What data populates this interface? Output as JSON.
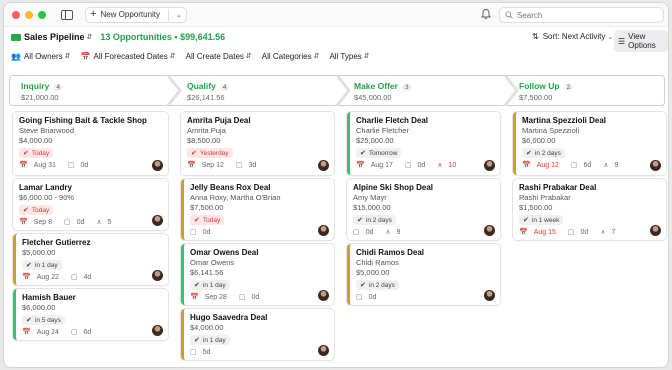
{
  "toolbar": {
    "new_label": "New Opportunity",
    "search_placeholder": "Search"
  },
  "header": {
    "pipeline": "Sales Pipeline",
    "summary": "13 Opportunities • $99,641.56",
    "sort": "Sort: Next Activity",
    "view_options": "View Options"
  },
  "filters": [
    "All Owners",
    "All Forecasted Dates",
    "All Create Dates",
    "All Categories",
    "All Types"
  ],
  "stages": [
    {
      "name": "Inquiry",
      "count": "4",
      "amount": "$21,000.00"
    },
    {
      "name": "Qualify",
      "count": "4",
      "amount": "$26,141.56"
    },
    {
      "name": "Make Offer",
      "count": "3",
      "amount": "$45,000.00"
    },
    {
      "name": "Follow Up",
      "count": "2",
      "amount": "$7,500.00"
    }
  ],
  "cards": {
    "c1": {
      "title": "Going Fishing Bait & Tackle Shop",
      "sub": "Steve Briarwood",
      "amt": "$4,000.00",
      "badge": "Today",
      "date": "Aug 31",
      "n1": "0d"
    },
    "c2": {
      "title": "Lamar Landry",
      "amt": "$6,000.00 - 90%",
      "badge": "Today",
      "date": "Sep 8",
      "n1": "0d",
      "n2": "5"
    },
    "c3": {
      "title": "Fletcher Gutierrez",
      "amt": "$5,000.00",
      "badge": "in 1 day",
      "date": "Aug 22",
      "n1": "4d"
    },
    "c4": {
      "title": "Hamish Bauer",
      "amt": "$6,000.00",
      "badge": "in 5 days",
      "date": "Aug 24",
      "n1": "6d"
    },
    "c5": {
      "title": "Amrita Puja Deal",
      "sub": "Amrita Puja",
      "amt": "$8,500.00",
      "badge": "Yesterday",
      "date": "Sep 12",
      "n1": "3d"
    },
    "c6": {
      "title": "Jelly Beans Rox Deal",
      "sub": "Anna Roxy, Martha O'Brian",
      "amt": "$7,500.00",
      "badge": "Today",
      "n1": "0d"
    },
    "c7": {
      "title": "Omar Owens Deal",
      "sub": "Omar Owens",
      "amt": "$6,141.56",
      "badge": "in 1 day",
      "date": "Sep 28",
      "n1": "0d"
    },
    "c8": {
      "title": "Hugo Saavedra Deal",
      "amt": "$4,000.00",
      "badge": "in 1 day",
      "n1": "5d"
    },
    "c9": {
      "title": "Charlie Fletch Deal",
      "sub": "Charlie Fletcher",
      "amt": "$25,000.00",
      "badge": "Tomorrow",
      "date": "Aug 17",
      "n1": "0d",
      "n2": "10"
    },
    "c10": {
      "title": "Alpine Ski Shop Deal",
      "sub": "Amy Mayr",
      "amt": "$15,000.00",
      "badge": "in 2 days",
      "n1": "0d",
      "n2": "9"
    },
    "c11": {
      "title": "Chidi Ramos Deal",
      "sub": "Chidi Ramos",
      "amt": "$5,000.00",
      "badge": "in 2 days",
      "n1": "0d"
    },
    "c12": {
      "title": "Martina Spezzioli Deal",
      "sub": "Martina Spezzioli",
      "amt": "$6,000.00",
      "badge": "in 2 days",
      "date": "Aug 12",
      "n1": "6d",
      "n2": "9"
    },
    "c13": {
      "title": "Rashi Prabakar Deal",
      "sub": "Rashi Prabakar",
      "amt": "$1,500.00",
      "badge": "in 1 week",
      "date": "Aug 15",
      "n1": "0d",
      "n2": "7"
    }
  }
}
